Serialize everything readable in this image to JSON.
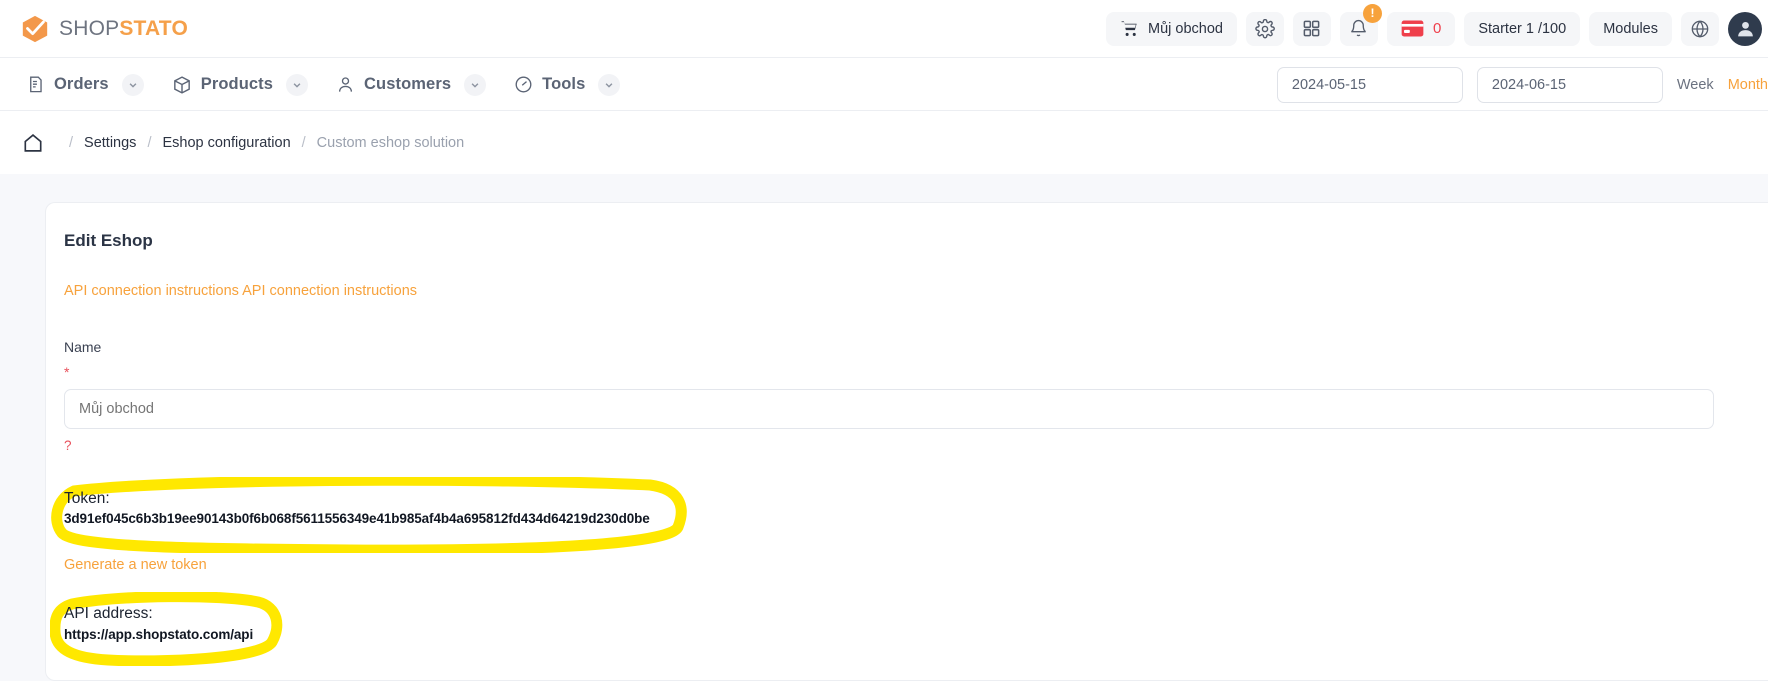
{
  "brand": {
    "shop": "SHOP",
    "stato": "STATO"
  },
  "header": {
    "store_button": "Můj obchod",
    "settings_icon": "gear-icon",
    "apps_icon": "grid-icon",
    "notifications_icon": "bell-icon",
    "notification_badge": "!",
    "credits_icon": "credit-card-icon",
    "credits_value": "0",
    "plan_label": "Starter 1 /100",
    "modules_label": "Modules",
    "language_icon": "globe-icon",
    "avatar_icon": "user-avatar"
  },
  "nav": {
    "items": [
      {
        "label": "Orders",
        "icon": "orders-icon"
      },
      {
        "label": "Products",
        "icon": "products-box-icon"
      },
      {
        "label": "Customers",
        "icon": "customers-person-icon"
      },
      {
        "label": "Tools",
        "icon": "tools-gauge-icon"
      }
    ],
    "date_from": "2024-05-15",
    "date_to": "2024-06-15",
    "range_week": "Week",
    "range_month": "Month"
  },
  "breadcrumb": {
    "home_icon": "home-icon",
    "separator": "/",
    "items": [
      "Settings",
      "Eshop configuration",
      "Custom eshop solution"
    ]
  },
  "card": {
    "title": "Edit Eshop",
    "api_instructions_link": "API connection instructions API connection instructions",
    "name_label": "Name",
    "required_mark": "*",
    "name_value": "Můj obchod",
    "name_placeholder": "Můj obchod",
    "help_marker": "?",
    "token_label": "Token:",
    "token_value": "3d91ef045c6b3b19ee90143b0f6b068f5611556349e41b985af4b4a695812fd434d64219d230d0be",
    "generate_token_link": "Generate a new token",
    "api_address_label": "API address:",
    "api_address_value": "https://app.shopstato.com/api"
  },
  "colors": {
    "brand_orange": "#f7a23c",
    "danger_red": "#e8505b",
    "highlight_yellow": "#ffe800",
    "nav_text": "#5b6475"
  }
}
